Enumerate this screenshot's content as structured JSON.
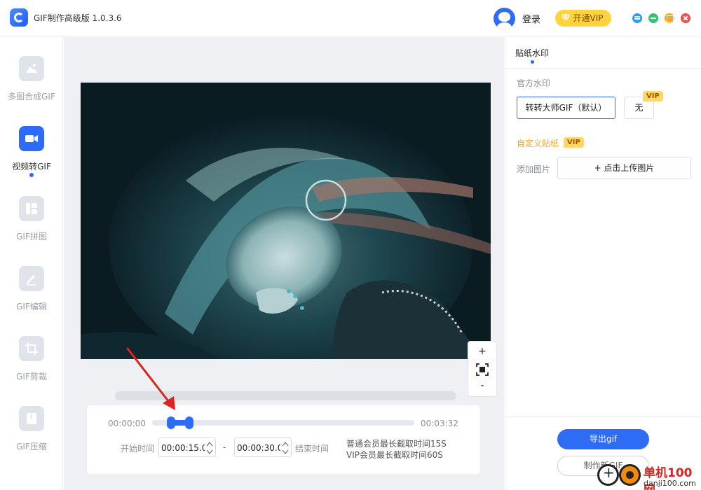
{
  "app": {
    "title": "GIF制作高级版 1.0.3.6"
  },
  "header": {
    "login_label": "登录",
    "vip_label": "开通VIP"
  },
  "sidebar": {
    "items": [
      {
        "label": "多图合成GIF",
        "icon": "image-stack-icon",
        "active": false
      },
      {
        "label": "视频转GIF",
        "icon": "video-camera-icon",
        "active": true
      },
      {
        "label": "GIF拼图",
        "icon": "collage-icon",
        "active": false
      },
      {
        "label": "GIF编辑",
        "icon": "edit-pencil-icon",
        "active": false
      },
      {
        "label": "GIF剪裁",
        "icon": "crop-icon",
        "active": false
      },
      {
        "label": "GIF压缩",
        "icon": "compress-icon",
        "active": false
      }
    ]
  },
  "preview": {
    "zoom_in": "+",
    "zoom_out": "-"
  },
  "timeline": {
    "start_time": "00:00:00",
    "end_time": "00:03:32",
    "selection_start_fraction": 0.071,
    "selection_end_fraction": 0.142,
    "start_label": "开始时间",
    "start_value": "00:00:15.0",
    "end_label": "结束时间",
    "end_value": "00:00:30.0",
    "dash": "-",
    "note_normal": "普通会员最长截取时间15S",
    "note_vip": "VIP会员最长截取时间60S"
  },
  "right_panel": {
    "tab_label": "贴纸水印",
    "official_title": "官方水印",
    "default_option": "转转大师GIF（默认）",
    "none_option": "无",
    "vip_tag": "VIP",
    "custom_title": "自定义贴纸",
    "add_image_label": "添加图片",
    "upload_label": "+ 点击上传图片",
    "export_label": "导出gif",
    "make_another_label": "制作新GIF"
  },
  "site_watermark": {
    "name": "单机100网",
    "url": "danji100.com"
  },
  "colors": {
    "accent": "#2f6cf6",
    "vip_gold": "#ffd33b",
    "custom_orange": "#f5a524",
    "annotation_red": "#e0231e"
  }
}
